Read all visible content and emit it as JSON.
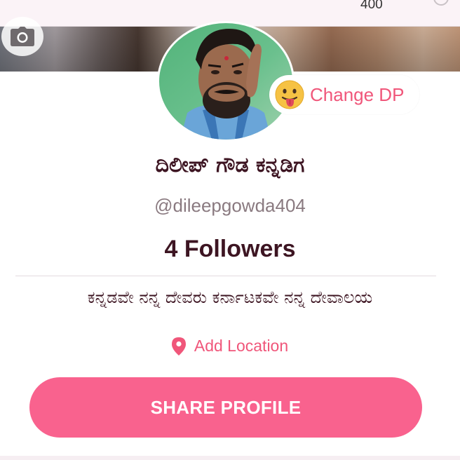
{
  "status": {
    "count": "400"
  },
  "cover": {
    "camera_icon": "camera-icon"
  },
  "profile": {
    "avatar": "profile-photo",
    "change_dp_label": "Change DP",
    "change_dp_icon": "tongue-out-emoji-icon",
    "name": "ದಿಲೀಪ್ ಗೌಡ ಕನ್ನಡಿಗ",
    "handle": "@dileepgowda404",
    "followers": "4 Followers",
    "bio": "ಕನ್ನಡವೇ ನನ್ನ ದೇವರು ಕರ್ನಾಟಕವೇ  ನನ್ನ ದೇವಾಲಯ",
    "location_icon": "location-pin-icon",
    "location_label": "Add Location"
  },
  "actions": {
    "share_label": "SHARE PROFILE"
  },
  "colors": {
    "accent": "#f0567a",
    "button": "#f9628e",
    "name_text": "#3d1522",
    "muted_text": "#8a7a80"
  }
}
